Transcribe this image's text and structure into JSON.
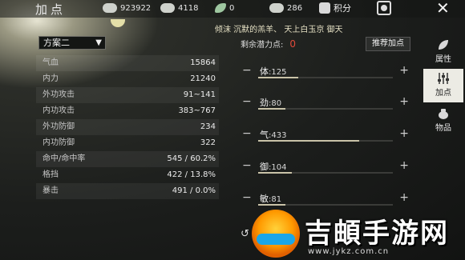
{
  "header": {
    "title": "加点",
    "resources": [
      {
        "icon": "coin-icon",
        "value": "923922"
      },
      {
        "icon": "silver-icon",
        "value": "4118"
      },
      {
        "icon": "leaf-icon",
        "value": "0"
      },
      {
        "icon": "ingot-icon",
        "value": "286"
      }
    ],
    "points_label": "积分",
    "close_label": "✕"
  },
  "banner": "倾沫 沉默的羔羊、 天上白玉京 御天",
  "plan": {
    "selected": "方案二",
    "arrow": "▼"
  },
  "stats": [
    {
      "label": "气血",
      "value": "15864"
    },
    {
      "label": "内力",
      "value": "21240"
    },
    {
      "label": "外功攻击",
      "value": "91~141"
    },
    {
      "label": "内功攻击",
      "value": "383~767"
    },
    {
      "label": "外功防御",
      "value": "234"
    },
    {
      "label": "内功防御",
      "value": "322"
    },
    {
      "label": "命中/命中率",
      "value": "545 / 60.2%"
    },
    {
      "label": "格挡",
      "value": "422 / 13.8%"
    },
    {
      "label": "暴击",
      "value": "491 / 0.0%"
    }
  ],
  "potential": {
    "label": "剩余潜力点:",
    "value": "0"
  },
  "recommend_label": "推荐加点",
  "attributes": [
    {
      "name": "体",
      "value": "125",
      "level": 0.3
    },
    {
      "name": "劲",
      "value": "80",
      "level": 0.2
    },
    {
      "name": "气",
      "value": "433",
      "level": 0.75
    },
    {
      "name": "御",
      "value": "104",
      "level": 0.25
    },
    {
      "name": "敏",
      "value": "81",
      "level": 0.2
    }
  ],
  "tabs": [
    {
      "label": "属性",
      "icon": "leaf-icon"
    },
    {
      "label": "加点",
      "icon": "sliders-icon"
    },
    {
      "label": "物品",
      "icon": "bag-icon"
    }
  ],
  "controls": {
    "minus": "−",
    "plus": "+",
    "reset": "↺"
  },
  "watermark": {
    "text": "吉頔手游网",
    "url": "www.jykz.com.cn"
  }
}
